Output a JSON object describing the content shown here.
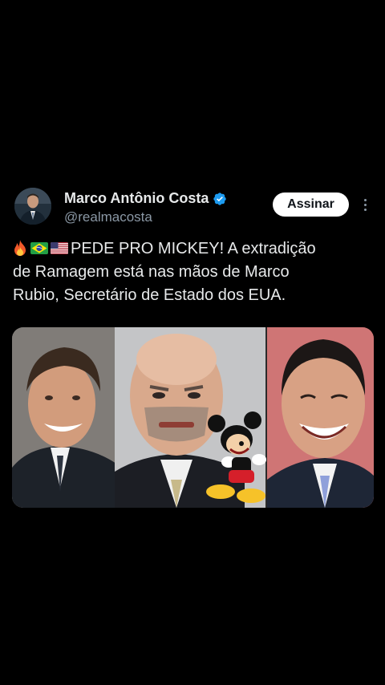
{
  "author": {
    "name": "Marco Antônio Costa",
    "handle": "@realmacosta",
    "verified": true
  },
  "actions": {
    "subscribe_label": "Assinar",
    "more_icon": "more-vertical-icon"
  },
  "tweet": {
    "emoji_prefix": [
      "fire-icon",
      "brazil-flag-icon",
      "us-flag-icon"
    ],
    "text_line1": "PEDE PRO MICKEY! A extradição",
    "text_line2": "de Ramagem está nas mãos de Marco",
    "text_line3": "Rubio, Secretário de Estado dos EUA."
  },
  "media": {
    "type": "photo-collage",
    "panels": [
      "man-smiling-left",
      "bald-man-center",
      "mickey-mouse-cartoon",
      "man-laughing-right"
    ]
  },
  "colors": {
    "background": "#000000",
    "text_primary": "#e7e9ea",
    "text_secondary": "#8b98a5",
    "verified_blue": "#1d9bf0",
    "button_bg": "#ffffff"
  }
}
